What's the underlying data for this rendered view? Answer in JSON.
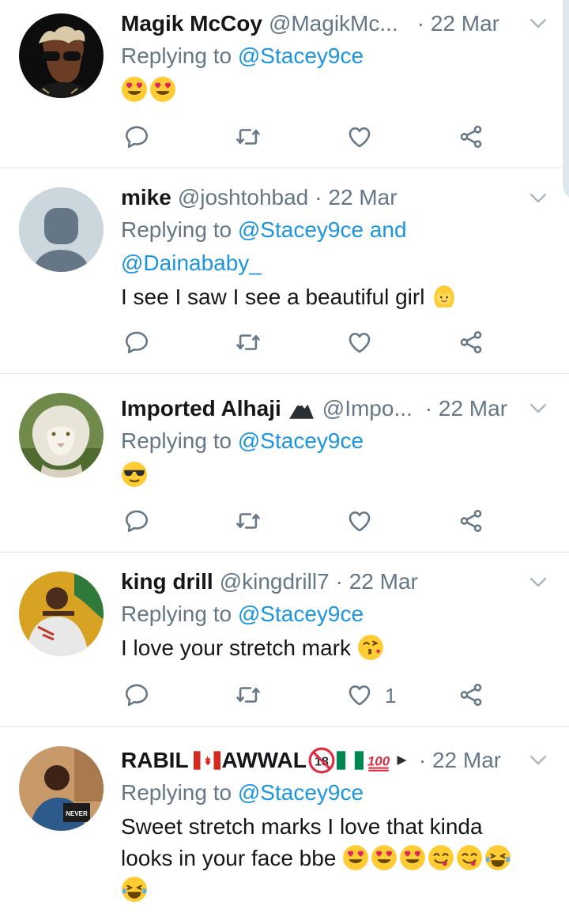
{
  "tweets": [
    {
      "name": "Magik McCoy",
      "handle": "@MagikMc...",
      "date": "· 22 Mar",
      "reply_prefix": "Replying to",
      "reply_to": "@Stacey9ce",
      "text": "",
      "emojis": [
        "heart-eyes",
        "heart-eyes"
      ],
      "like_count": ""
    },
    {
      "name": "mike",
      "handle": "@joshtohbad",
      "date": "· 22 Mar",
      "reply_prefix": "Replying to",
      "reply_to": "@Stacey9ce and @Dainababy_",
      "text": "I see I saw I see a beautiful girl",
      "emojis": [
        "blonde-person"
      ],
      "like_count": ""
    },
    {
      "name": "Imported Alhaji",
      "handle": "@Impo...",
      "date": "· 22 Mar",
      "reply_prefix": "Replying to",
      "reply_to": "@Stacey9ce",
      "text": "",
      "emojis": [
        "sunglasses"
      ],
      "like_count": ""
    },
    {
      "name": "king drill",
      "handle": "@kingdrill7",
      "date": "· 22 Mar",
      "reply_prefix": "Replying to",
      "reply_to": "@Stacey9ce",
      "text": "I love your stretch mark",
      "emojis": [
        "kiss-face"
      ],
      "like_count": "1"
    },
    {
      "name": "RABIL",
      "name2": "AWWAL",
      "handle": "",
      "date": "· 22 Mar",
      "reply_prefix": "Replying to",
      "reply_to": "@Stacey9ce",
      "text_line1": "Sweet stretch marks I love that kinda",
      "text_line2": "looks in your face bbe",
      "emojis": [
        "heart-eyes",
        "heart-eyes",
        "heart-eyes",
        "yum",
        "yum",
        "tears-of-joy",
        "tears-of-joy"
      ],
      "like_count": ""
    }
  ],
  "colors": {
    "link": "#1b95e0",
    "muted": "#657786",
    "divider": "#e1e8ed"
  },
  "icons": [
    "reply-icon",
    "retweet-icon",
    "like-icon",
    "share-icon",
    "chevron-down-icon"
  ]
}
